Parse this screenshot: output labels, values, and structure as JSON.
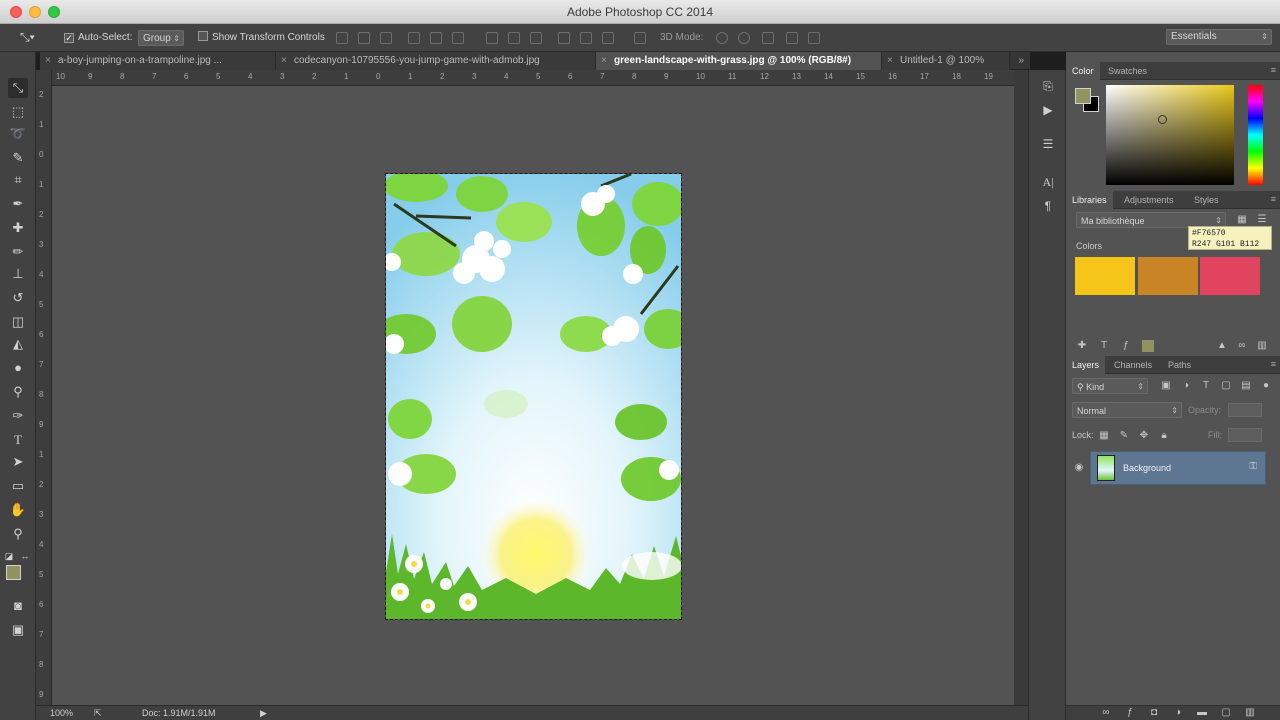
{
  "window": {
    "title": "Adobe Photoshop CC 2014"
  },
  "options_bar": {
    "auto_select_label": "Auto-Select:",
    "auto_select_value": "Group",
    "show_transform_label": "Show Transform Controls",
    "mode_3d_label": "3D Mode:",
    "workspace": "Essentials"
  },
  "tabs": [
    {
      "label": "a-boy-jumping-on-a-trampoline.jpg ..."
    },
    {
      "label": "codecanyon-10795556-you-jump-game-with-admob.jpg"
    },
    {
      "label": "green-landscape-with-grass.jpg @ 100% (RGB/8#)"
    },
    {
      "label": "Untitled-1 @ 100%"
    }
  ],
  "ruler": {
    "h": [
      "10",
      "9",
      "8",
      "7",
      "6",
      "5",
      "4",
      "3",
      "2",
      "1",
      "0",
      "1",
      "2",
      "3",
      "4",
      "5",
      "6",
      "7",
      "8",
      "9",
      "10",
      "11",
      "12",
      "13",
      "14",
      "15",
      "16",
      "17",
      "18",
      "19"
    ],
    "v": [
      "2",
      "1",
      "0",
      "1",
      "2",
      "3",
      "4",
      "5",
      "6",
      "7",
      "8",
      "9",
      "1",
      "2",
      "3",
      "4",
      "5",
      "6",
      "7",
      "8",
      "9"
    ]
  },
  "status": {
    "zoom": "100%",
    "doc": "Doc: 1.91M/1.91M"
  },
  "color_panel": {
    "tabs": [
      "Color",
      "Swatches"
    ]
  },
  "libraries_panel": {
    "tabs": [
      "Libraries",
      "Adjustments",
      "Styles"
    ],
    "library_name": "Ma bibliothèque",
    "colors_heading": "Colors",
    "swatches": [
      "#f6c51a",
      "#c98426",
      "#e1445f"
    ],
    "tooltip_hex": "#F76570",
    "tooltip_rgb": "R247 G101 B112"
  },
  "layers_panel": {
    "tabs": [
      "Layers",
      "Channels",
      "Paths"
    ],
    "filter_kind": "Kind",
    "blend_mode": "Normal",
    "opacity_label": "Opacity:",
    "lock_label": "Lock:",
    "fill_label": "Fill:",
    "layers": [
      {
        "name": "Background"
      }
    ]
  }
}
